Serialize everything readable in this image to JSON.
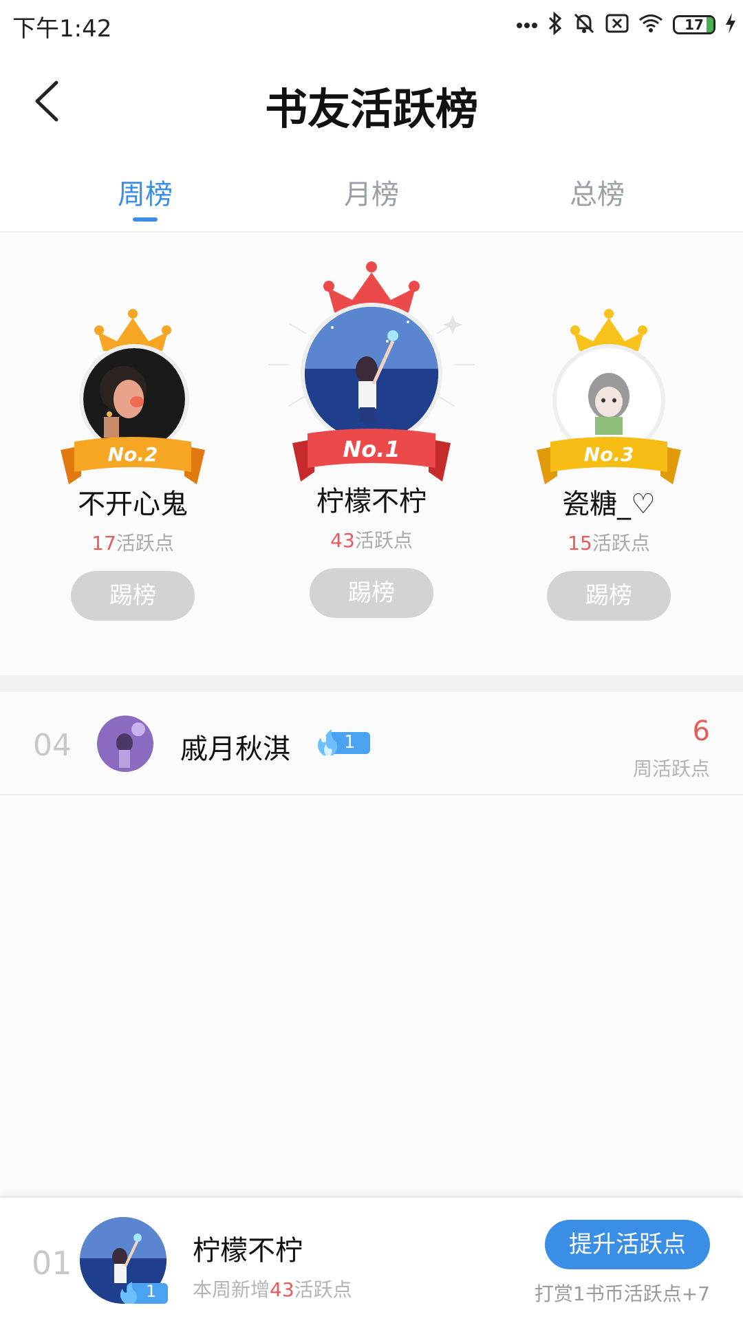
{
  "status_bar": {
    "time": "下午1:42",
    "battery_level": "17",
    "icons": [
      "more-dots-icon",
      "bluetooth-icon",
      "mute-icon",
      "no-sim-icon",
      "wifi-icon",
      "battery-icon",
      "charging-icon"
    ]
  },
  "header": {
    "title": "书友活跃榜",
    "back_icon": "back-chevron-icon"
  },
  "tabs": [
    {
      "label": "周榜",
      "active": true
    },
    {
      "label": "月榜",
      "active": false
    },
    {
      "label": "总榜",
      "active": false
    }
  ],
  "podium": [
    {
      "rank_label": "No.2",
      "name": "不开心鬼",
      "points": "17",
      "points_suffix": "活跃点",
      "button_label": "踢榜",
      "crown_color": "#f6a623",
      "ribbon_color": "#f08a1c"
    },
    {
      "rank_label": "No.1",
      "name": "柠檬不柠",
      "points": "43",
      "points_suffix": "活跃点",
      "button_label": "踢榜",
      "crown_color": "#ec4a4a",
      "ribbon_color": "#e23d3d"
    },
    {
      "rank_label": "No.3",
      "name": "瓷糖_♡",
      "points": "15",
      "points_suffix": "活跃点",
      "button_label": "踢榜",
      "crown_color": "#f7c21a",
      "ribbon_color": "#f2a90e"
    }
  ],
  "list": [
    {
      "rank": "04",
      "name": "戚月秋淇",
      "level": "1",
      "score": "6",
      "score_label": "周活跃点"
    }
  ],
  "me": {
    "rank": "01",
    "name": "柠檬不柠",
    "level": "1",
    "sub_prefix": "本周新增",
    "sub_value": "43",
    "sub_suffix": "活跃点",
    "boost_label": "提升活跃点",
    "reward_text": "打赏1书币活跃点+7"
  },
  "colors": {
    "accent": "#3a8ee6",
    "points": "#e85b5b",
    "button_gray": "#d3d3d3"
  }
}
